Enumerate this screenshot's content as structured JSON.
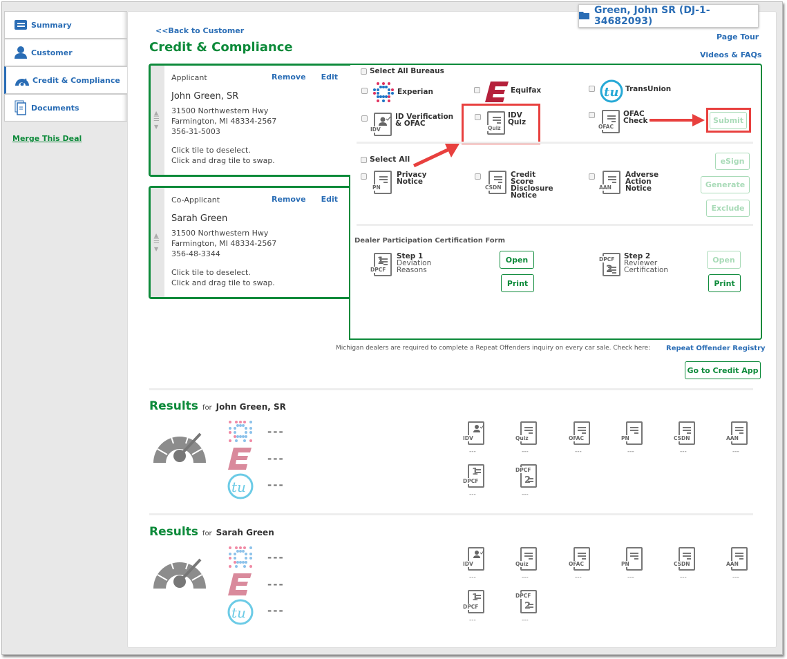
{
  "sidebar": {
    "items": [
      {
        "label": "Summary",
        "icon": "folder-list-icon"
      },
      {
        "label": "Customer",
        "icon": "person-icon"
      },
      {
        "label": "Credit & Compliance",
        "icon": "gauge-icon",
        "active": true
      },
      {
        "label": "Documents",
        "icon": "documents-icon"
      }
    ],
    "merge_link": "Merge This Deal"
  },
  "header": {
    "deal_label": "Green, John SR (DJ-1-34682093)",
    "back_link": "<<Back to Customer",
    "page_title": "Credit & Compliance",
    "page_tour": "Page Tour",
    "videos": "Videos & FAQs"
  },
  "applicants": [
    {
      "role": "Applicant",
      "name": "John Green, SR",
      "address1": "31500 Northwestern Hwy",
      "address2": "Farmington, MI 48334-2567",
      "ssn": "356-31-5003",
      "hint1": "Click tile to deselect.",
      "hint2": "Click and drag tile to swap.",
      "remove": "Remove",
      "edit": "Edit"
    },
    {
      "role": "Co-Applicant",
      "name": "Sarah Green",
      "address1": "31500 Northwestern Hwy",
      "address2": "Farmington, MI 48334-2567",
      "ssn": "356-48-3344",
      "hint1": "Click tile to deselect.",
      "hint2": "Click and drag tile to swap.",
      "remove": "Remove",
      "edit": "Edit"
    }
  ],
  "bureaus": {
    "select_all": "Select All Bureaus",
    "experian": "Experian",
    "equifax": "Equifax",
    "transunion": "TransUnion",
    "idv": {
      "line1": "ID Verification",
      "line2": "& OFAC",
      "tag": "IDV"
    },
    "quiz": {
      "line1": "IDV",
      "line2": "Quiz",
      "tag": "Quiz"
    },
    "ofac": {
      "line1": "OFAC",
      "line2": "Check",
      "tag": "OFAC"
    },
    "submit": "Submit"
  },
  "notices": {
    "select_all": "Select All",
    "pn": {
      "lines": [
        "Privacy",
        "Notice"
      ],
      "tag": "PN"
    },
    "csdn": {
      "lines": [
        "Credit",
        "Score",
        "Disclosure",
        "Notice"
      ],
      "tag": "CSDN"
    },
    "aan": {
      "lines": [
        "Adverse",
        "Action",
        "Notice"
      ],
      "tag": "AAN"
    },
    "esign": "eSign",
    "generate": "Generate",
    "exclude": "Exclude"
  },
  "dpcf": {
    "title": "Dealer Participation Certification Form",
    "step1": {
      "title": "Step 1",
      "line1": "Deviation",
      "line2": "Reasons",
      "tag": "DPCF",
      "num": "1"
    },
    "step2": {
      "title": "Step 2",
      "line1": "Reviewer",
      "line2": "Certification",
      "tag": "DPCF",
      "num": "2"
    },
    "open": "Open",
    "print": "Print"
  },
  "notice_text": "Michigan dealers are required to complete a Repeat Offenders inquiry on every car sale. Check here:",
  "registry_link": "Repeat Offender Registry",
  "credit_app_btn": "Go to Credit App",
  "results": [
    {
      "heading": "Results",
      "for": "for",
      "name": "John Green, SR",
      "bureau_values": [
        "---",
        "---",
        "---"
      ],
      "doc_values": [
        "---",
        "---",
        "---",
        "---",
        "---",
        "---",
        "---",
        "---"
      ]
    },
    {
      "heading": "Results",
      "for": "for",
      "name": "Sarah Green",
      "bureau_values": [
        "---",
        "---",
        "---"
      ],
      "doc_values": [
        "---",
        "---",
        "---",
        "---",
        "---",
        "---",
        "---",
        "---"
      ]
    }
  ],
  "result_docs": [
    "IDV",
    "Quiz",
    "OFAC",
    "PN",
    "CSDN",
    "AAN",
    "DPCF",
    "DPCF"
  ],
  "colors": {
    "brand_green": "#0d8a3a",
    "link_blue": "#2a6db5",
    "annotation_red": "#e8403e"
  }
}
